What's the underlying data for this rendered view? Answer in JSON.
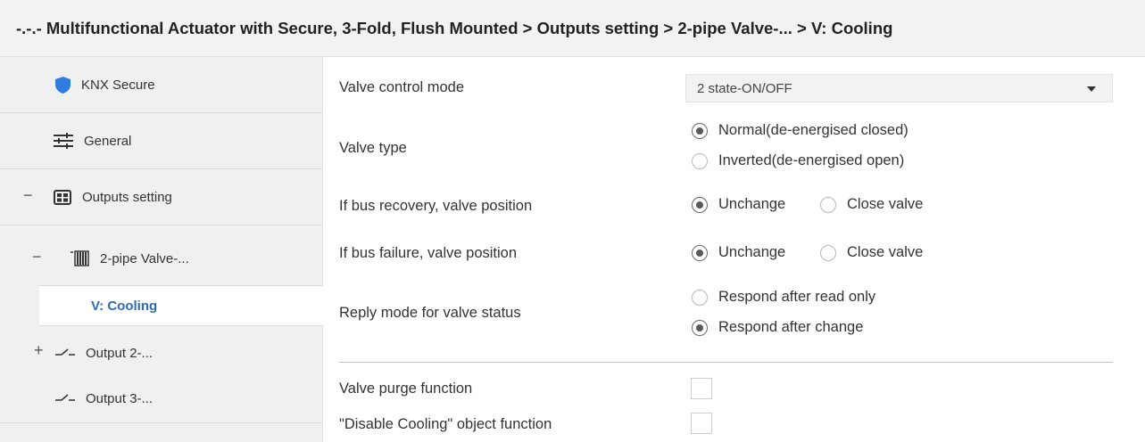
{
  "breadcrumb": "-.-.- Multifunctional Actuator with Secure, 3-Fold, Flush Mounted > Outputs setting > 2-pipe Valve-... > V: Cooling",
  "sidebar": {
    "items": [
      {
        "label": "KNX Secure",
        "icon": "shield-icon"
      },
      {
        "label": "General",
        "icon": "sliders-icon"
      },
      {
        "label": "Outputs setting",
        "icon": "module-icon",
        "expander": "−"
      },
      {
        "label": "2-pipe Valve-...",
        "icon": "radiator-icon",
        "expander": "−"
      },
      {
        "label": "V: Cooling"
      },
      {
        "label": "Output 2-...",
        "icon": "switch-icon",
        "expander": "+"
      },
      {
        "label": "Output 3-...",
        "icon": "switch-icon"
      }
    ]
  },
  "params": {
    "valve_control_mode": {
      "label": "Valve control mode",
      "value": "2 state-ON/OFF"
    },
    "valve_type": {
      "label": "Valve type",
      "options": [
        "Normal(de-energised closed)",
        "Inverted(de-energised open)"
      ],
      "selected": 0
    },
    "bus_recovery": {
      "label": "If bus recovery, valve position",
      "options": [
        "Unchange",
        "Close valve"
      ],
      "selected": 0
    },
    "bus_failure": {
      "label": "If bus failure, valve position",
      "options": [
        "Unchange",
        "Close valve"
      ],
      "selected": 0
    },
    "reply_mode": {
      "label": "Reply mode for valve status",
      "options": [
        "Respond after read only",
        "Respond after change"
      ],
      "selected": 1
    },
    "valve_purge": {
      "label": "Valve purge function",
      "checked": false
    },
    "disable_cooling": {
      "label": "\"Disable Cooling\" object function",
      "checked": false
    }
  },
  "colors": {
    "active_nav_text": "#2b6db3",
    "shield": "#2f7de1"
  }
}
